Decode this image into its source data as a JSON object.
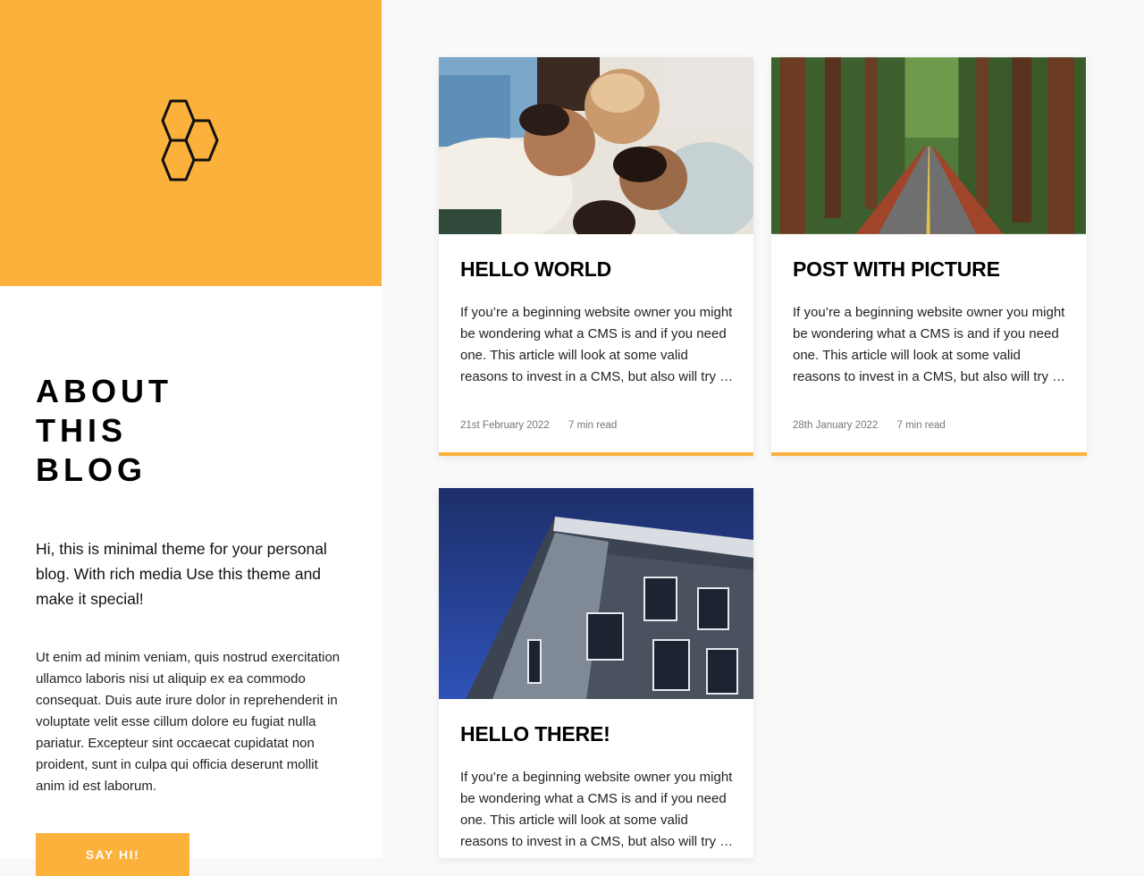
{
  "colors": {
    "accent": "#fbb13c",
    "text": "#111111",
    "background": "#f9f9f9"
  },
  "sidebar": {
    "logo_icon": "honeycomb-hexagons-icon",
    "title_lines": [
      "ABOUT",
      "THIS",
      "BLOG"
    ],
    "lead": "Hi, this is minimal theme for your personal blog. With rich media Use this theme and make it special!",
    "body": "Ut enim ad minim veniam, quis nostrud exercitation ullamco laboris nisi ut aliquip ex ea commodo consequat. Duis aute irure dolor in reprehenderit in voluptate velit esse cillum dolore eu fugiat nulla pariatur. Excepteur sint occaecat cupidatat non proident, sunt in culpa qui officia deserunt mollit anim id est laborum.",
    "button_label": "SAY HI!"
  },
  "posts": [
    {
      "title": "HELLO WORLD",
      "excerpt": "If you’re a beginning website owner you might be wondering what a CMS is and if you need one. This article will look at some valid reasons to invest in a CMS, but also will try …",
      "date": "21st February 2022",
      "read_time": "7 min read",
      "image": "friends-lying-together-photo"
    },
    {
      "title": "POST WITH PICTURE",
      "excerpt": "If you’re a beginning website owner you might be wondering what a CMS is and if you need one. This article will look at some valid reasons to invest in a CMS, but also will try …",
      "date": "28th January 2022",
      "read_time": "7 min read",
      "image": "redwood-forest-road-photo"
    },
    {
      "title": "HELLO THERE!",
      "excerpt": "If you’re a beginning website owner you might be wondering what a CMS is and if you need one. This article will look at some valid reasons to invest in a CMS, but also will try …",
      "image": "modern-building-sky-photo"
    }
  ]
}
